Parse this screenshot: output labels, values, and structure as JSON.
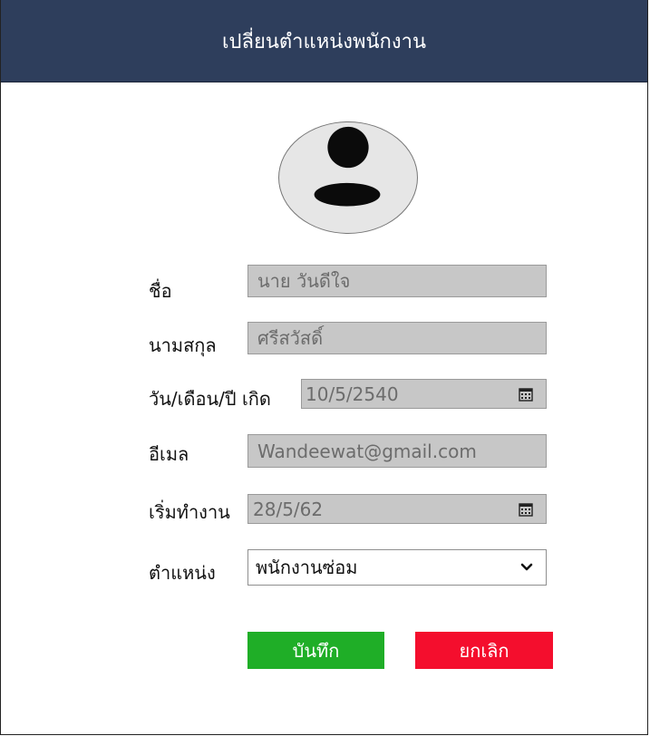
{
  "header": {
    "title": "เปลี่ยนตำแหน่งพนักงาน"
  },
  "avatar": {
    "icon": "user-silhouette-icon"
  },
  "form": {
    "first_name": {
      "label": "ชื่อ",
      "value": "นาย วันดีใจ"
    },
    "last_name": {
      "label": "นามสกุล",
      "value": "ศรีสวัสดิ์"
    },
    "birth_date": {
      "label": "วัน/เดือน/ปี เกิด",
      "value": "10/5/2540",
      "icon": "calendar-icon"
    },
    "email": {
      "label": "อีเมล",
      "value": "Wandeewat@gmail.com"
    },
    "start_date": {
      "label": "เริ่มทำงาน",
      "value": "28/5/62",
      "icon": "calendar-icon"
    },
    "position": {
      "label": "ตำแหน่ง",
      "value": "พนักงานซ่อม",
      "icon": "chevron-down-icon"
    }
  },
  "actions": {
    "save_label": "บันทึก",
    "cancel_label": "ยกเลิก"
  },
  "colors": {
    "header_bg": "#2e3e5c",
    "save_bg": "#1fae27",
    "cancel_bg": "#f40e2d",
    "field_bg": "#c7c7c7"
  }
}
